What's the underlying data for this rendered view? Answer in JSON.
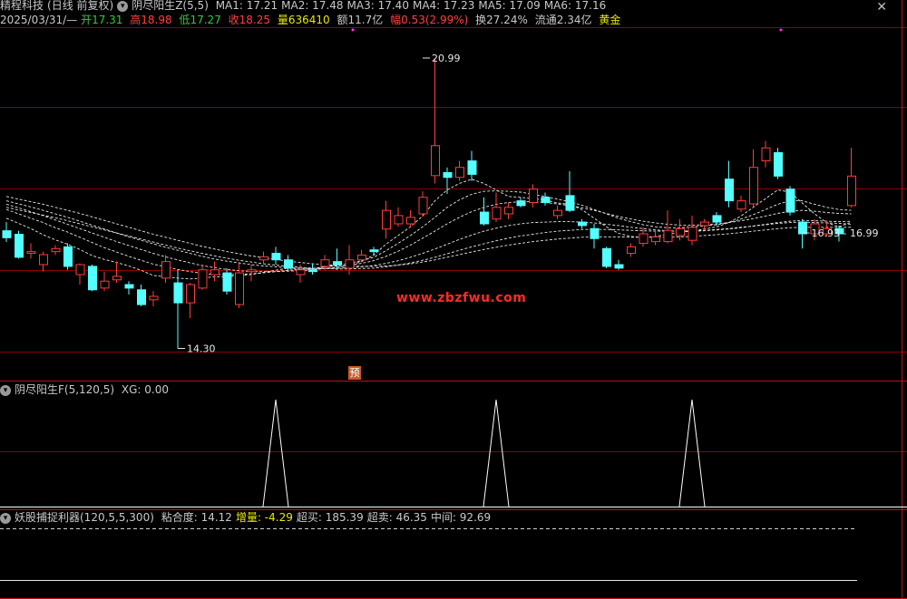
{
  "header": {
    "stock_name": "精程科技",
    "period": "(日线 前复权)",
    "indicator_name": "阴尽阳生Z(5,5)",
    "ma": [
      {
        "label": "MA1: 17.21",
        "color": "#c8c8c8"
      },
      {
        "label": "MA2: 17.48",
        "color": "#c8c8c8"
      },
      {
        "label": "MA3: 17.40",
        "color": "#c8c8c8"
      },
      {
        "label": "MA4: 17.23",
        "color": "#c8c8c8"
      },
      {
        "label": "MA5: 17.09",
        "color": "#c8c8c8"
      },
      {
        "label": "MA6: 17.16",
        "color": "#c8c8c8"
      }
    ],
    "date": "2025/03/31/—",
    "open_label": "开",
    "open": "17.31",
    "high_label": "高",
    "high": "18.98",
    "low_label": "低",
    "low": "17.27",
    "close_label": "收",
    "close": "18.25",
    "vol_label": "量",
    "vol": "636410",
    "amount_label": "额",
    "amount": "11.7亿",
    "change_label": "幅",
    "change": "0.53(2.99%)",
    "turnover_label": "换",
    "turnover": "27.24%",
    "float_label": "流通",
    "float": "2.34亿",
    "tag": "黄金",
    "close_symbol": "✕"
  },
  "sub1": {
    "title": "阴尽阳生F(5,120,5)",
    "xg": "XG: 0.00"
  },
  "sub2": {
    "title": "妖股捕捉利器(120,5,5,300)",
    "items": [
      {
        "label": "粘合度: 14.12",
        "color": "#c8c8c8"
      },
      {
        "label": "增量: -4.29",
        "color": "#e8e800"
      },
      {
        "label": "超买: 185.39",
        "color": "#c8c8c8"
      },
      {
        "label": "超卖: 46.35",
        "color": "#c8c8c8"
      },
      {
        "label": "中间: 92.69",
        "color": "#c8c8c8"
      }
    ]
  },
  "watermark": "www.zbzfwu.com",
  "pre_tag": "预",
  "colors": {
    "up": "#ff3c3c",
    "down": "#54ffff",
    "grid": "#8b0000",
    "ma": "#e6e6e6"
  },
  "chart_data": {
    "type": "candlestick",
    "ylim": [
      13.6,
      21.7
    ],
    "annotations": [
      {
        "label": "20.99",
        "index": 34,
        "value": 20.99
      },
      {
        "label": "14.30",
        "index": 14,
        "value": 14.3
      },
      {
        "label": "16.93 - 16.99",
        "index": 65,
        "value": 16.96
      }
    ],
    "candles": [
      {
        "o": 17.01,
        "c": 16.85,
        "h": 17.21,
        "l": 16.75
      },
      {
        "o": 16.93,
        "c": 16.4,
        "h": 17.01,
        "l": 16.37
      },
      {
        "o": 16.49,
        "c": 16.53,
        "h": 16.72,
        "l": 16.37
      },
      {
        "o": 16.23,
        "c": 16.46,
        "h": 16.53,
        "l": 16.07
      },
      {
        "o": 16.53,
        "c": 16.6,
        "h": 16.68,
        "l": 16.45
      },
      {
        "o": 16.64,
        "c": 16.19,
        "h": 16.72,
        "l": 16.11
      },
      {
        "o": 16.0,
        "c": 16.23,
        "h": 16.26,
        "l": 15.77
      },
      {
        "o": 16.19,
        "c": 15.65,
        "h": 16.23,
        "l": 15.62
      },
      {
        "o": 15.69,
        "c": 15.85,
        "h": 16.07,
        "l": 15.62
      },
      {
        "o": 15.88,
        "c": 15.96,
        "h": 16.3,
        "l": 15.81
      },
      {
        "o": 15.77,
        "c": 15.69,
        "h": 15.85,
        "l": 15.54
      },
      {
        "o": 15.65,
        "c": 15.31,
        "h": 15.77,
        "l": 15.27
      },
      {
        "o": 15.42,
        "c": 15.5,
        "h": 15.62,
        "l": 15.27
      },
      {
        "o": 15.92,
        "c": 16.3,
        "h": 16.45,
        "l": 15.81
      },
      {
        "o": 15.81,
        "c": 15.35,
        "h": 16.11,
        "l": 14.3
      },
      {
        "o": 15.35,
        "c": 15.77,
        "h": 15.81,
        "l": 15.0
      },
      {
        "o": 15.69,
        "c": 16.11,
        "h": 16.23,
        "l": 15.65
      },
      {
        "o": 16.0,
        "c": 16.11,
        "h": 16.3,
        "l": 15.85
      },
      {
        "o": 16.04,
        "c": 15.62,
        "h": 16.15,
        "l": 15.54
      },
      {
        "o": 15.31,
        "c": 16.04,
        "h": 16.26,
        "l": 15.23
      },
      {
        "o": 16.07,
        "c": 16.11,
        "h": 16.23,
        "l": 15.85
      },
      {
        "o": 16.34,
        "c": 16.41,
        "h": 16.53,
        "l": 16.23
      },
      {
        "o": 16.49,
        "c": 16.34,
        "h": 16.64,
        "l": 16.23
      },
      {
        "o": 16.34,
        "c": 16.15,
        "h": 16.45,
        "l": 16.07
      },
      {
        "o": 16.0,
        "c": 16.11,
        "h": 16.23,
        "l": 15.81
      },
      {
        "o": 16.11,
        "c": 16.07,
        "h": 16.26,
        "l": 16.0
      },
      {
        "o": 16.19,
        "c": 16.34,
        "h": 16.45,
        "l": 16.11
      },
      {
        "o": 16.3,
        "c": 16.23,
        "h": 16.6,
        "l": 16.11
      },
      {
        "o": 16.15,
        "c": 16.34,
        "h": 16.68,
        "l": 16.0
      },
      {
        "o": 16.34,
        "c": 16.45,
        "h": 16.57,
        "l": 16.3
      },
      {
        "o": 16.57,
        "c": 16.53,
        "h": 16.64,
        "l": 16.45
      },
      {
        "o": 17.05,
        "c": 17.48,
        "h": 17.7,
        "l": 16.83
      },
      {
        "o": 17.17,
        "c": 17.36,
        "h": 17.55,
        "l": 17.1
      },
      {
        "o": 17.17,
        "c": 17.32,
        "h": 17.48,
        "l": 17.1
      },
      {
        "o": 17.4,
        "c": 17.78,
        "h": 17.92,
        "l": 17.33
      },
      {
        "o": 18.28,
        "c": 18.97,
        "h": 20.99,
        "l": 18.1
      },
      {
        "o": 18.35,
        "c": 18.24,
        "h": 18.47,
        "l": 17.86
      },
      {
        "o": 18.24,
        "c": 18.47,
        "h": 18.62,
        "l": 18.16
      },
      {
        "o": 18.62,
        "c": 18.31,
        "h": 18.85,
        "l": 18.16
      },
      {
        "o": 17.44,
        "c": 17.17,
        "h": 17.78,
        "l": 17.13
      },
      {
        "o": 17.28,
        "c": 17.55,
        "h": 17.89,
        "l": 17.21
      },
      {
        "o": 17.4,
        "c": 17.55,
        "h": 17.66,
        "l": 17.28
      },
      {
        "o": 17.7,
        "c": 17.59,
        "h": 17.78,
        "l": 17.55
      },
      {
        "o": 17.66,
        "c": 17.97,
        "h": 18.08,
        "l": 17.55
      },
      {
        "o": 17.78,
        "c": 17.66,
        "h": 17.89,
        "l": 17.59
      },
      {
        "o": 17.36,
        "c": 17.48,
        "h": 17.59,
        "l": 17.28
      },
      {
        "o": 17.82,
        "c": 17.48,
        "h": 18.38,
        "l": 17.44
      },
      {
        "o": 17.21,
        "c": 17.13,
        "h": 17.28,
        "l": 17.06
      },
      {
        "o": 17.06,
        "c": 16.83,
        "h": 17.17,
        "l": 16.6
      },
      {
        "o": 16.6,
        "c": 16.19,
        "h": 16.64,
        "l": 16.15
      },
      {
        "o": 16.23,
        "c": 16.15,
        "h": 16.34,
        "l": 16.11
      },
      {
        "o": 16.49,
        "c": 16.64,
        "h": 16.72,
        "l": 16.41
      },
      {
        "o": 16.72,
        "c": 16.94,
        "h": 17.09,
        "l": 16.64
      },
      {
        "o": 16.76,
        "c": 16.87,
        "h": 17.02,
        "l": 16.68
      },
      {
        "o": 16.76,
        "c": 17.02,
        "h": 17.48,
        "l": 16.72
      },
      {
        "o": 16.9,
        "c": 17.06,
        "h": 17.28,
        "l": 16.79
      },
      {
        "o": 16.79,
        "c": 17.09,
        "h": 17.36,
        "l": 16.68
      },
      {
        "o": 17.13,
        "c": 17.21,
        "h": 17.28,
        "l": 17.02
      },
      {
        "o": 17.36,
        "c": 17.21,
        "h": 17.44,
        "l": 17.13
      },
      {
        "o": 18.2,
        "c": 17.7,
        "h": 18.62,
        "l": 17.55
      },
      {
        "o": 17.51,
        "c": 17.7,
        "h": 17.82,
        "l": 17.44
      },
      {
        "o": 17.63,
        "c": 18.47,
        "h": 18.89,
        "l": 17.55
      },
      {
        "o": 18.62,
        "c": 18.92,
        "h": 19.08,
        "l": 18.47
      },
      {
        "o": 18.81,
        "c": 18.27,
        "h": 18.92,
        "l": 18.2
      },
      {
        "o": 17.97,
        "c": 17.44,
        "h": 18.04,
        "l": 17.36
      },
      {
        "o": 17.21,
        "c": 16.94,
        "h": 17.28,
        "l": 16.6
      },
      {
        "o": 16.94,
        "c": 17.17,
        "h": 17.28,
        "l": 16.79
      },
      {
        "o": 16.94,
        "c": 17.06,
        "h": 17.21,
        "l": 16.87
      },
      {
        "o": 17.06,
        "c": 16.94,
        "h": 17.13,
        "l": 16.76
      },
      {
        "o": 17.59,
        "c": 18.27,
        "h": 18.92,
        "l": 17.55
      }
    ],
    "ma_lines": [
      [
        17.3,
        17.18,
        17.06,
        16.92,
        16.8,
        16.7,
        16.58,
        16.44,
        16.35,
        16.28,
        16.2,
        16.1,
        15.98,
        15.95,
        15.92,
        15.9,
        15.92,
        15.95,
        15.95,
        15.98,
        16.0,
        16.05,
        16.1,
        16.15,
        16.12,
        16.13,
        16.18,
        16.2,
        16.22,
        16.3,
        16.45,
        16.7,
        16.9,
        17.1,
        17.35,
        17.7,
        17.95,
        18.1,
        18.2,
        18.1,
        17.95,
        17.8,
        17.78,
        17.75,
        17.72,
        17.65,
        17.62,
        17.5,
        17.3,
        17.1,
        16.95,
        16.88,
        16.85,
        16.88,
        16.93,
        16.98,
        17.0,
        17.05,
        17.1,
        17.2,
        17.35,
        17.55,
        17.75,
        17.95,
        17.9,
        17.65,
        17.4,
        17.2,
        17.1,
        17.21
      ],
      [
        17.5,
        17.4,
        17.3,
        17.2,
        17.08,
        16.98,
        16.86,
        16.74,
        16.62,
        16.52,
        16.42,
        16.33,
        16.24,
        16.18,
        16.12,
        16.07,
        16.03,
        16.0,
        16.0,
        16.0,
        16.02,
        16.04,
        16.07,
        16.1,
        16.12,
        16.14,
        16.18,
        16.22,
        16.26,
        16.32,
        16.4,
        16.55,
        16.72,
        16.9,
        17.1,
        17.32,
        17.55,
        17.72,
        17.85,
        17.92,
        17.93,
        17.92,
        17.9,
        17.85,
        17.8,
        17.74,
        17.68,
        17.6,
        17.5,
        17.4,
        17.3,
        17.22,
        17.15,
        17.1,
        17.08,
        17.08,
        17.1,
        17.12,
        17.15,
        17.2,
        17.28,
        17.38,
        17.5,
        17.62,
        17.7,
        17.7,
        17.62,
        17.55,
        17.5,
        17.48
      ],
      [
        17.62,
        17.54,
        17.45,
        17.36,
        17.26,
        17.16,
        17.06,
        16.96,
        16.86,
        16.76,
        16.67,
        16.58,
        16.49,
        16.41,
        16.34,
        16.27,
        16.21,
        16.16,
        16.12,
        16.09,
        16.07,
        16.07,
        16.07,
        16.08,
        16.09,
        16.11,
        16.14,
        16.17,
        16.21,
        16.26,
        16.32,
        16.42,
        16.54,
        16.68,
        16.84,
        17.0,
        17.17,
        17.32,
        17.45,
        17.55,
        17.62,
        17.66,
        17.68,
        17.68,
        17.66,
        17.63,
        17.59,
        17.54,
        17.48,
        17.41,
        17.34,
        17.28,
        17.23,
        17.19,
        17.16,
        17.14,
        17.14,
        17.15,
        17.17,
        17.2,
        17.24,
        17.29,
        17.35,
        17.41,
        17.46,
        17.48,
        17.46,
        17.43,
        17.41,
        17.4
      ],
      [
        17.7,
        17.63,
        17.56,
        17.48,
        17.4,
        17.32,
        17.23,
        17.14,
        17.05,
        16.96,
        16.87,
        16.79,
        16.71,
        16.63,
        16.56,
        16.49,
        16.42,
        16.36,
        16.31,
        16.27,
        16.23,
        16.2,
        16.18,
        16.16,
        16.15,
        16.14,
        16.14,
        16.15,
        16.16,
        16.18,
        16.21,
        16.26,
        16.32,
        16.4,
        16.49,
        16.59,
        16.7,
        16.81,
        16.91,
        17.0,
        17.07,
        17.13,
        17.17,
        17.2,
        17.21,
        17.22,
        17.22,
        17.21,
        17.19,
        17.16,
        17.13,
        17.09,
        17.06,
        17.03,
        17.01,
        17.0,
        17.0,
        17.01,
        17.03,
        17.05,
        17.08,
        17.12,
        17.16,
        17.2,
        17.23,
        17.25,
        17.24,
        17.23,
        17.22,
        17.23
      ],
      [
        17.8,
        17.74,
        17.68,
        17.62,
        17.55,
        17.48,
        17.41,
        17.33,
        17.25,
        17.17,
        17.09,
        17.01,
        16.93,
        16.86,
        16.79,
        16.72,
        16.65,
        16.59,
        16.53,
        16.48,
        16.43,
        16.39,
        16.35,
        16.31,
        16.28,
        16.25,
        16.23,
        16.21,
        16.2,
        16.19,
        16.19,
        16.2,
        16.22,
        16.25,
        16.29,
        16.34,
        16.4,
        16.46,
        16.52,
        16.58,
        16.63,
        16.68,
        16.72,
        16.76,
        16.79,
        16.82,
        16.84,
        16.86,
        16.87,
        16.87,
        16.87,
        16.86,
        16.86,
        16.86,
        16.86,
        16.87,
        16.88,
        16.9,
        16.92,
        16.94,
        16.97,
        17.0,
        17.03,
        17.06,
        17.08,
        17.09,
        17.09,
        17.09,
        17.09,
        17.09
      ],
      [
        17.55,
        17.49,
        17.43,
        17.37,
        17.31,
        17.24,
        17.17,
        17.1,
        17.03,
        16.96,
        16.89,
        16.82,
        16.75,
        16.68,
        16.61,
        16.55,
        16.49,
        16.43,
        16.38,
        16.33,
        16.29,
        16.25,
        16.22,
        16.19,
        16.17,
        16.15,
        16.14,
        16.13,
        16.13,
        16.14,
        16.15,
        16.18,
        16.22,
        16.27,
        16.33,
        16.4,
        16.48,
        16.56,
        16.64,
        16.71,
        16.78,
        16.84,
        16.89,
        16.93,
        16.97,
        17.0,
        17.02,
        17.04,
        17.04,
        17.04,
        17.03,
        17.02,
        17.01,
        17.0,
        17.0,
        17.0,
        17.01,
        17.02,
        17.04,
        17.06,
        17.09,
        17.12,
        17.15,
        17.18,
        17.2,
        17.21,
        17.2,
        17.19,
        17.18,
        17.16
      ]
    ],
    "sub1_spikes": [
      22,
      40,
      56
    ],
    "sub2_lines": [
      {
        "name": "",
        "value": "upper-dashed"
      },
      {
        "name": "",
        "value": "lower-solid"
      }
    ]
  }
}
